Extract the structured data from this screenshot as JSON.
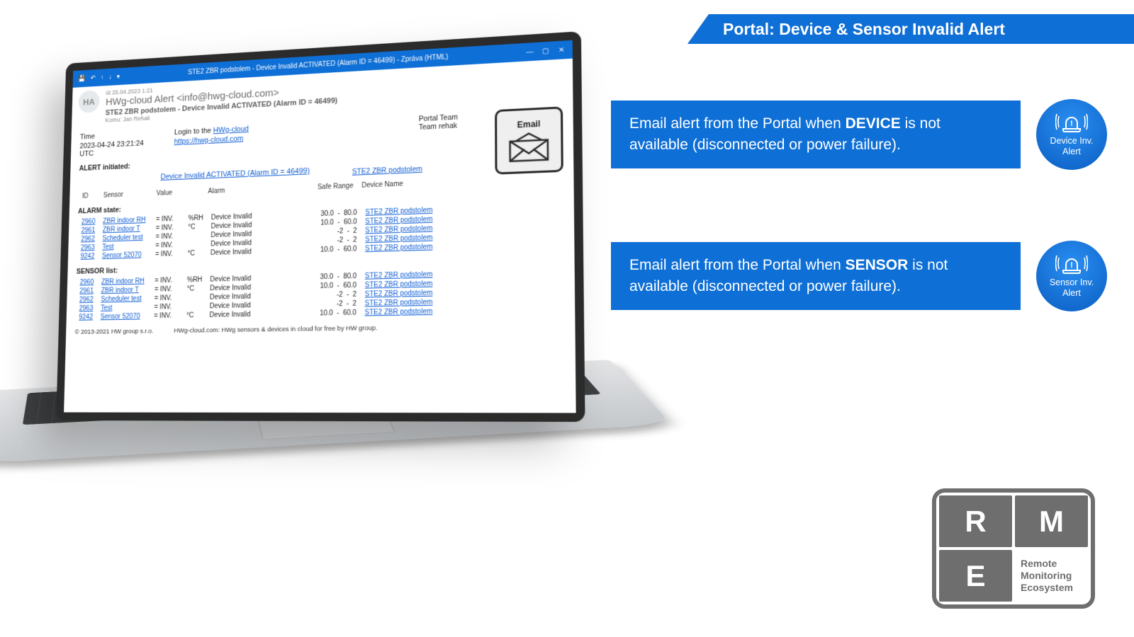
{
  "banner": {
    "title": "Portal: Device & Sensor Invalid Alert"
  },
  "callouts": [
    {
      "pre": "Email alert from the Portal when ",
      "bold": "DEVICE",
      "post": " is not available (disconnected or power failure).",
      "icon_label_1": "Device Inv.",
      "icon_label_2": "Alert"
    },
    {
      "pre": "Email alert from the Portal when ",
      "bold": "SENSOR",
      "post": " is not available (disconnected or power failure).",
      "icon_label_1": "Sensor Inv.",
      "icon_label_2": "Alert"
    }
  ],
  "rme_logo": {
    "r": "R",
    "m": "M",
    "e": "E",
    "line1": "Remote",
    "line2": "Monitoring",
    "line3": "Ecosystem"
  },
  "email": {
    "window_title": "STE2 ZBR podstolem - Device Invalid ACTIVATED (Alarm ID = 46499) - Zpráva (HTML)",
    "avatar": "HA",
    "received_stamp": "út 25.04.2023 1:21",
    "from": "HWg-cloud Alert <info@hwg-cloud.com>",
    "subject": "STE2 ZBR podstolem - Device Invalid ACTIVATED (Alarm ID = 46499)",
    "to_label": "Komu:",
    "to_value": "Jan Rehak",
    "time_label": "Time",
    "time_value": "2023-04-24 23:21:24 UTC",
    "login_label": "Login to the ",
    "login_link_text": "HWg-cloud",
    "login_url": "https://hwg-cloud.com",
    "portal_team": "Portal Team",
    "team": "Team rehak",
    "icon_label": "Email",
    "alert_initiated": "ALERT initiated:",
    "alert_link": "Device Invalid ACTIVATED (Alarm ID = 46499)",
    "device_link": "STE2 ZBR podstolem",
    "table_headers": {
      "id": "ID",
      "sensor": "Sensor",
      "value": "Value",
      "alarm": "Alarm",
      "safe": "Safe Range",
      "device": "Device Name"
    },
    "alarm_state_label": "ALARM state:",
    "sensor_list_label": "SENSOR list:",
    "rows": [
      {
        "id": "2960",
        "sensor": "ZBR indoor RH",
        "value": "INV.",
        "unit": "%RH",
        "alarm": "Device Invalid",
        "lo": "30.0",
        "hi": "80.0",
        "device": "STE2 ZBR podstolem"
      },
      {
        "id": "2961",
        "sensor": "ZBR indoor T",
        "value": "INV.",
        "unit": "°C",
        "alarm": "Device Invalid",
        "lo": "10.0",
        "hi": "60.0",
        "device": "STE2 ZBR podstolem"
      },
      {
        "id": "2962",
        "sensor": "Scheduler test",
        "value": "INV.",
        "unit": "",
        "alarm": "Device Invalid",
        "lo": "-2",
        "hi": "2",
        "device": "STE2 ZBR podstolem"
      },
      {
        "id": "2963",
        "sensor": "Test",
        "value": "INV.",
        "unit": "",
        "alarm": "Device Invalid",
        "lo": "-2",
        "hi": "2",
        "device": "STE2 ZBR podstolem"
      },
      {
        "id": "9242",
        "sensor": "Sensor 52070",
        "value": "INV.",
        "unit": "°C",
        "alarm": "Device Invalid",
        "lo": "10.0",
        "hi": "60.0",
        "device": "STE2 ZBR podstolem"
      }
    ],
    "footer_copyright": "© 2013-2021 HW group s.r.o.",
    "footer_text": "HWg-cloud.com: HWg sensors & devices in cloud for free by HW group."
  }
}
